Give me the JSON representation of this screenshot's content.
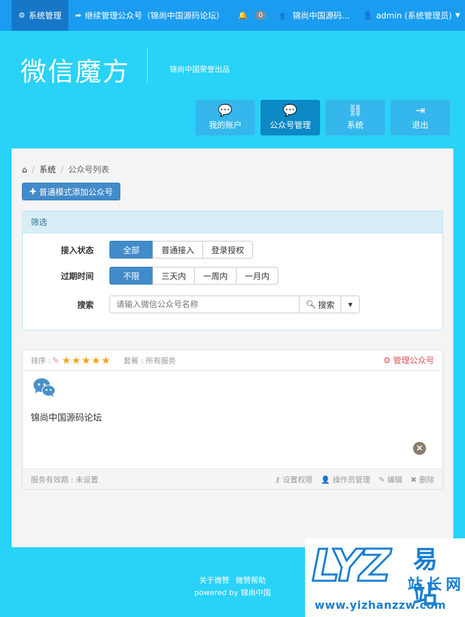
{
  "topbar": {
    "system_manage": "系统管理",
    "continue_manage": "继续管理公众号（锦尚中国源码论坛）",
    "notify_count": "0",
    "account_short": "锦尚中国源码...",
    "user": "admin (系统管理员)"
  },
  "header": {
    "logo": "微信魔方",
    "slogan": "锦尚中国荣誉出品"
  },
  "quicknav": {
    "items": [
      {
        "label": "我的账户"
      },
      {
        "label": "公众号管理"
      },
      {
        "label": "系统"
      },
      {
        "label": "退出"
      }
    ]
  },
  "breadcrumb": {
    "section": "系统",
    "current": "公众号列表",
    "separator": "/"
  },
  "add_button": "普通模式添加公众号",
  "filter": {
    "title": "筛选",
    "access_label": "接入状态",
    "access_options": [
      "全部",
      "普通接入",
      "登录授权"
    ],
    "expire_label": "过期时间",
    "expire_options": [
      "不限",
      "三天内",
      "一周内",
      "一月内"
    ],
    "search_label": "搜索",
    "search_placeholder": "请输入微信公众号名称",
    "search_button": "搜索"
  },
  "account_card": {
    "sort_label": "排序 :",
    "stars": "★★★★★",
    "package_label": "套餐 : 所有服务",
    "manage_link": "管理公众号",
    "name": "锦尚中国源码论坛",
    "validity": "服务有效期 : 未设置",
    "actions": {
      "permission": "设置权限",
      "operators": "操作员管理",
      "edit": "编辑",
      "delete": "删除"
    }
  },
  "footer": {
    "about": "关于微赞",
    "help": "微赞帮助",
    "powered": "powered by 锦尚中国"
  },
  "watermark": {
    "letters": "LYZ",
    "brand": "易站",
    "sub": "站长网",
    "url": "www.yizhanzzw.com"
  },
  "colors": {
    "page_bg": "#29d2f7",
    "topbar": "#1a9cf0",
    "primary": "#428bca",
    "danger": "#d9534f",
    "star": "#f7a21b"
  }
}
